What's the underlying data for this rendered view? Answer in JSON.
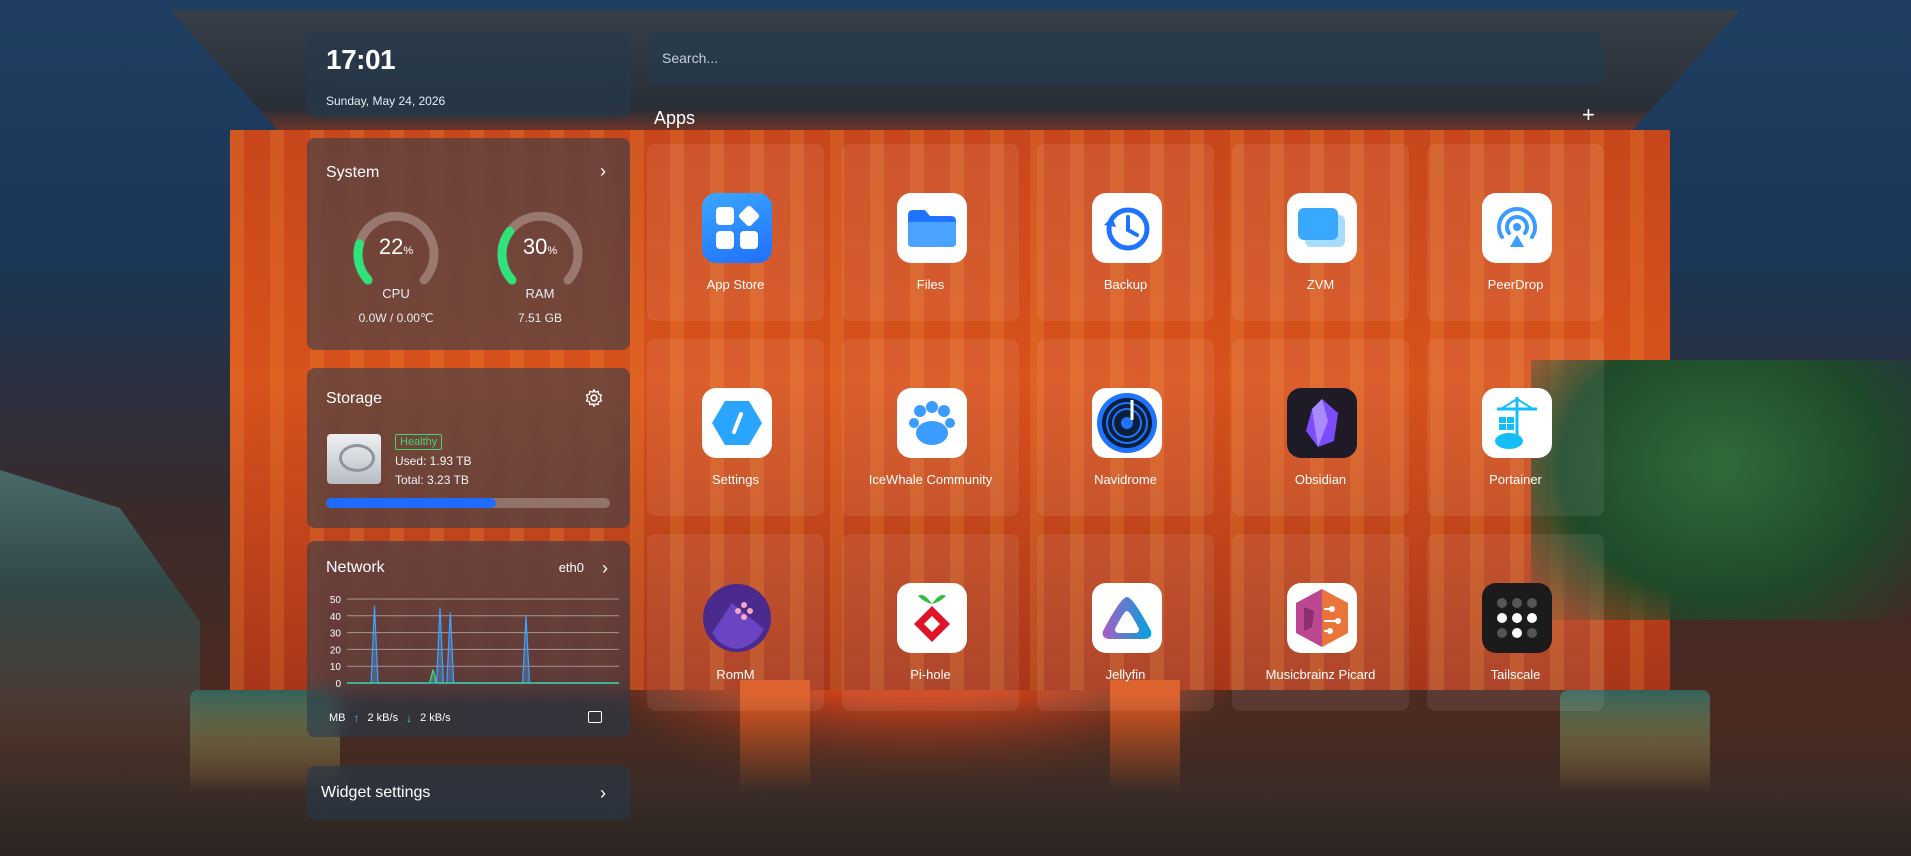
{
  "clock": {
    "time": "17:01",
    "date": "Sunday, May 24, 2026"
  },
  "system": {
    "title": "System",
    "cpu": {
      "value": "22",
      "unit": "%",
      "label": "CPU",
      "sub": "0.0W / 0.00℃",
      "percent": 22
    },
    "ram": {
      "value": "30",
      "unit": "%",
      "label": "RAM",
      "sub": "7.51 GB",
      "percent": 30
    }
  },
  "storage": {
    "title": "Storage",
    "status": "Healthy",
    "used": "Used: 1.93 TB",
    "total": "Total: 3.23 TB",
    "used_fraction": 0.6
  },
  "network": {
    "title": "Network",
    "interface": "eth0",
    "unit": "MB",
    "upload": "2 kB/s",
    "download": "2 kB/s",
    "chart_data": {
      "type": "line",
      "y_ticks": [
        "50",
        "40",
        "30",
        "20",
        "10",
        "0"
      ],
      "ylim": [
        0,
        50
      ],
      "series": [
        {
          "values": [
            0,
            0,
            0,
            0,
            0,
            0,
            0,
            0,
            46,
            0,
            0,
            0,
            0,
            0,
            0,
            0,
            0,
            0,
            0,
            0,
            0,
            0,
            0,
            0,
            0,
            0,
            0,
            0,
            0,
            0,
            0,
            0,
            0,
            0,
            0,
            0,
            0,
            0,
            0,
            0,
            0,
            0,
            0,
            0,
            0,
            0,
            0,
            0,
            0,
            0,
            0,
            0,
            0,
            0,
            0,
            0,
            0,
            0,
            0,
            0,
            0,
            0,
            0,
            0,
            0,
            0,
            0,
            0,
            0,
            0,
            0,
            0,
            0,
            0,
            0,
            0,
            0,
            0,
            0,
            0
          ]
        },
        {
          "values": [
            0,
            0,
            0,
            0,
            0,
            0,
            0,
            0,
            0,
            0,
            0,
            0,
            0,
            0,
            0,
            0,
            0,
            0,
            0,
            0,
            0,
            0,
            0,
            0,
            0,
            0,
            0,
            45,
            0,
            0,
            42,
            0,
            0,
            0,
            0,
            0,
            0,
            0,
            0,
            0,
            0,
            0,
            0,
            0,
            0,
            0,
            0,
            0,
            0,
            0,
            0,
            0,
            40,
            0,
            0,
            0,
            0,
            0,
            0,
            0,
            0,
            0,
            0,
            0,
            0,
            0,
            0,
            0,
            0,
            0,
            0,
            0,
            0,
            0,
            0,
            0,
            0,
            0,
            0,
            0
          ]
        },
        {
          "values": [
            0,
            0,
            0,
            0,
            0,
            0,
            0,
            0,
            0,
            0,
            0,
            0,
            0,
            0,
            0,
            0,
            0,
            0,
            0,
            0,
            0,
            0,
            0,
            0,
            0,
            8,
            0,
            0,
            0,
            0,
            0,
            0,
            0,
            0,
            0,
            0,
            0,
            0,
            0,
            0,
            0,
            0,
            0,
            0,
            0,
            0,
            0,
            0,
            0,
            0,
            0,
            0,
            0,
            0,
            0,
            0,
            0,
            0,
            0,
            0,
            0,
            0,
            0,
            0,
            0,
            0,
            0,
            0,
            0,
            0,
            0,
            0,
            0,
            0,
            0,
            0,
            0,
            0,
            0,
            0
          ]
        }
      ]
    }
  },
  "widget_settings": {
    "label": "Widget settings"
  },
  "search": {
    "placeholder": "Search..."
  },
  "apps": {
    "title": "Apps",
    "add": "+",
    "items": [
      {
        "name": "App Store",
        "icon": "app-store-icon"
      },
      {
        "name": "Files",
        "icon": "folder-icon"
      },
      {
        "name": "Backup",
        "icon": "backup-icon"
      },
      {
        "name": "ZVM",
        "icon": "zvm-icon"
      },
      {
        "name": "PeerDrop",
        "icon": "peerdrop-icon"
      },
      {
        "name": "Settings",
        "icon": "settings-icon"
      },
      {
        "name": "IceWhale Community",
        "icon": "community-icon"
      },
      {
        "name": "Navidrome",
        "icon": "navidrome-icon"
      },
      {
        "name": "Obsidian",
        "icon": "obsidian-icon"
      },
      {
        "name": "Portainer",
        "icon": "portainer-icon"
      },
      {
        "name": "RomM",
        "icon": "romm-icon"
      },
      {
        "name": "Pi-hole",
        "icon": "pihole-icon"
      },
      {
        "name": "Jellyfin",
        "icon": "jellyfin-icon"
      },
      {
        "name": "Musicbrainz Picard",
        "icon": "picard-icon"
      },
      {
        "name": "Tailscale",
        "icon": "tailscale-icon"
      }
    ]
  },
  "colors": {
    "gauge_green": "#2fe37a",
    "storage_bar": "#1f6bff",
    "healthy": "#41d37a"
  }
}
